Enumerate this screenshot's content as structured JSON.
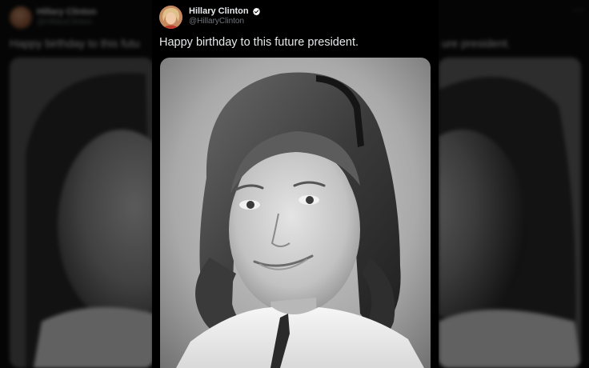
{
  "tweet": {
    "display_name": "Hillary Clinton",
    "handle": "@HillaryClinton",
    "text": "Happy birthday to this future president.",
    "verified": true,
    "avatar_icon": "profile-avatar",
    "verified_icon": "verified-badge-icon"
  },
  "background_copy": {
    "display_name": "Hillary Clinton",
    "handle": "@HillaryClinton",
    "text_left": "Happy birthday to this futu",
    "text_right": "ure president."
  },
  "colors": {
    "background": "#000000",
    "text_primary": "#e7e9ea",
    "text_secondary": "#71767b",
    "verified_badge": "#ffffff"
  }
}
